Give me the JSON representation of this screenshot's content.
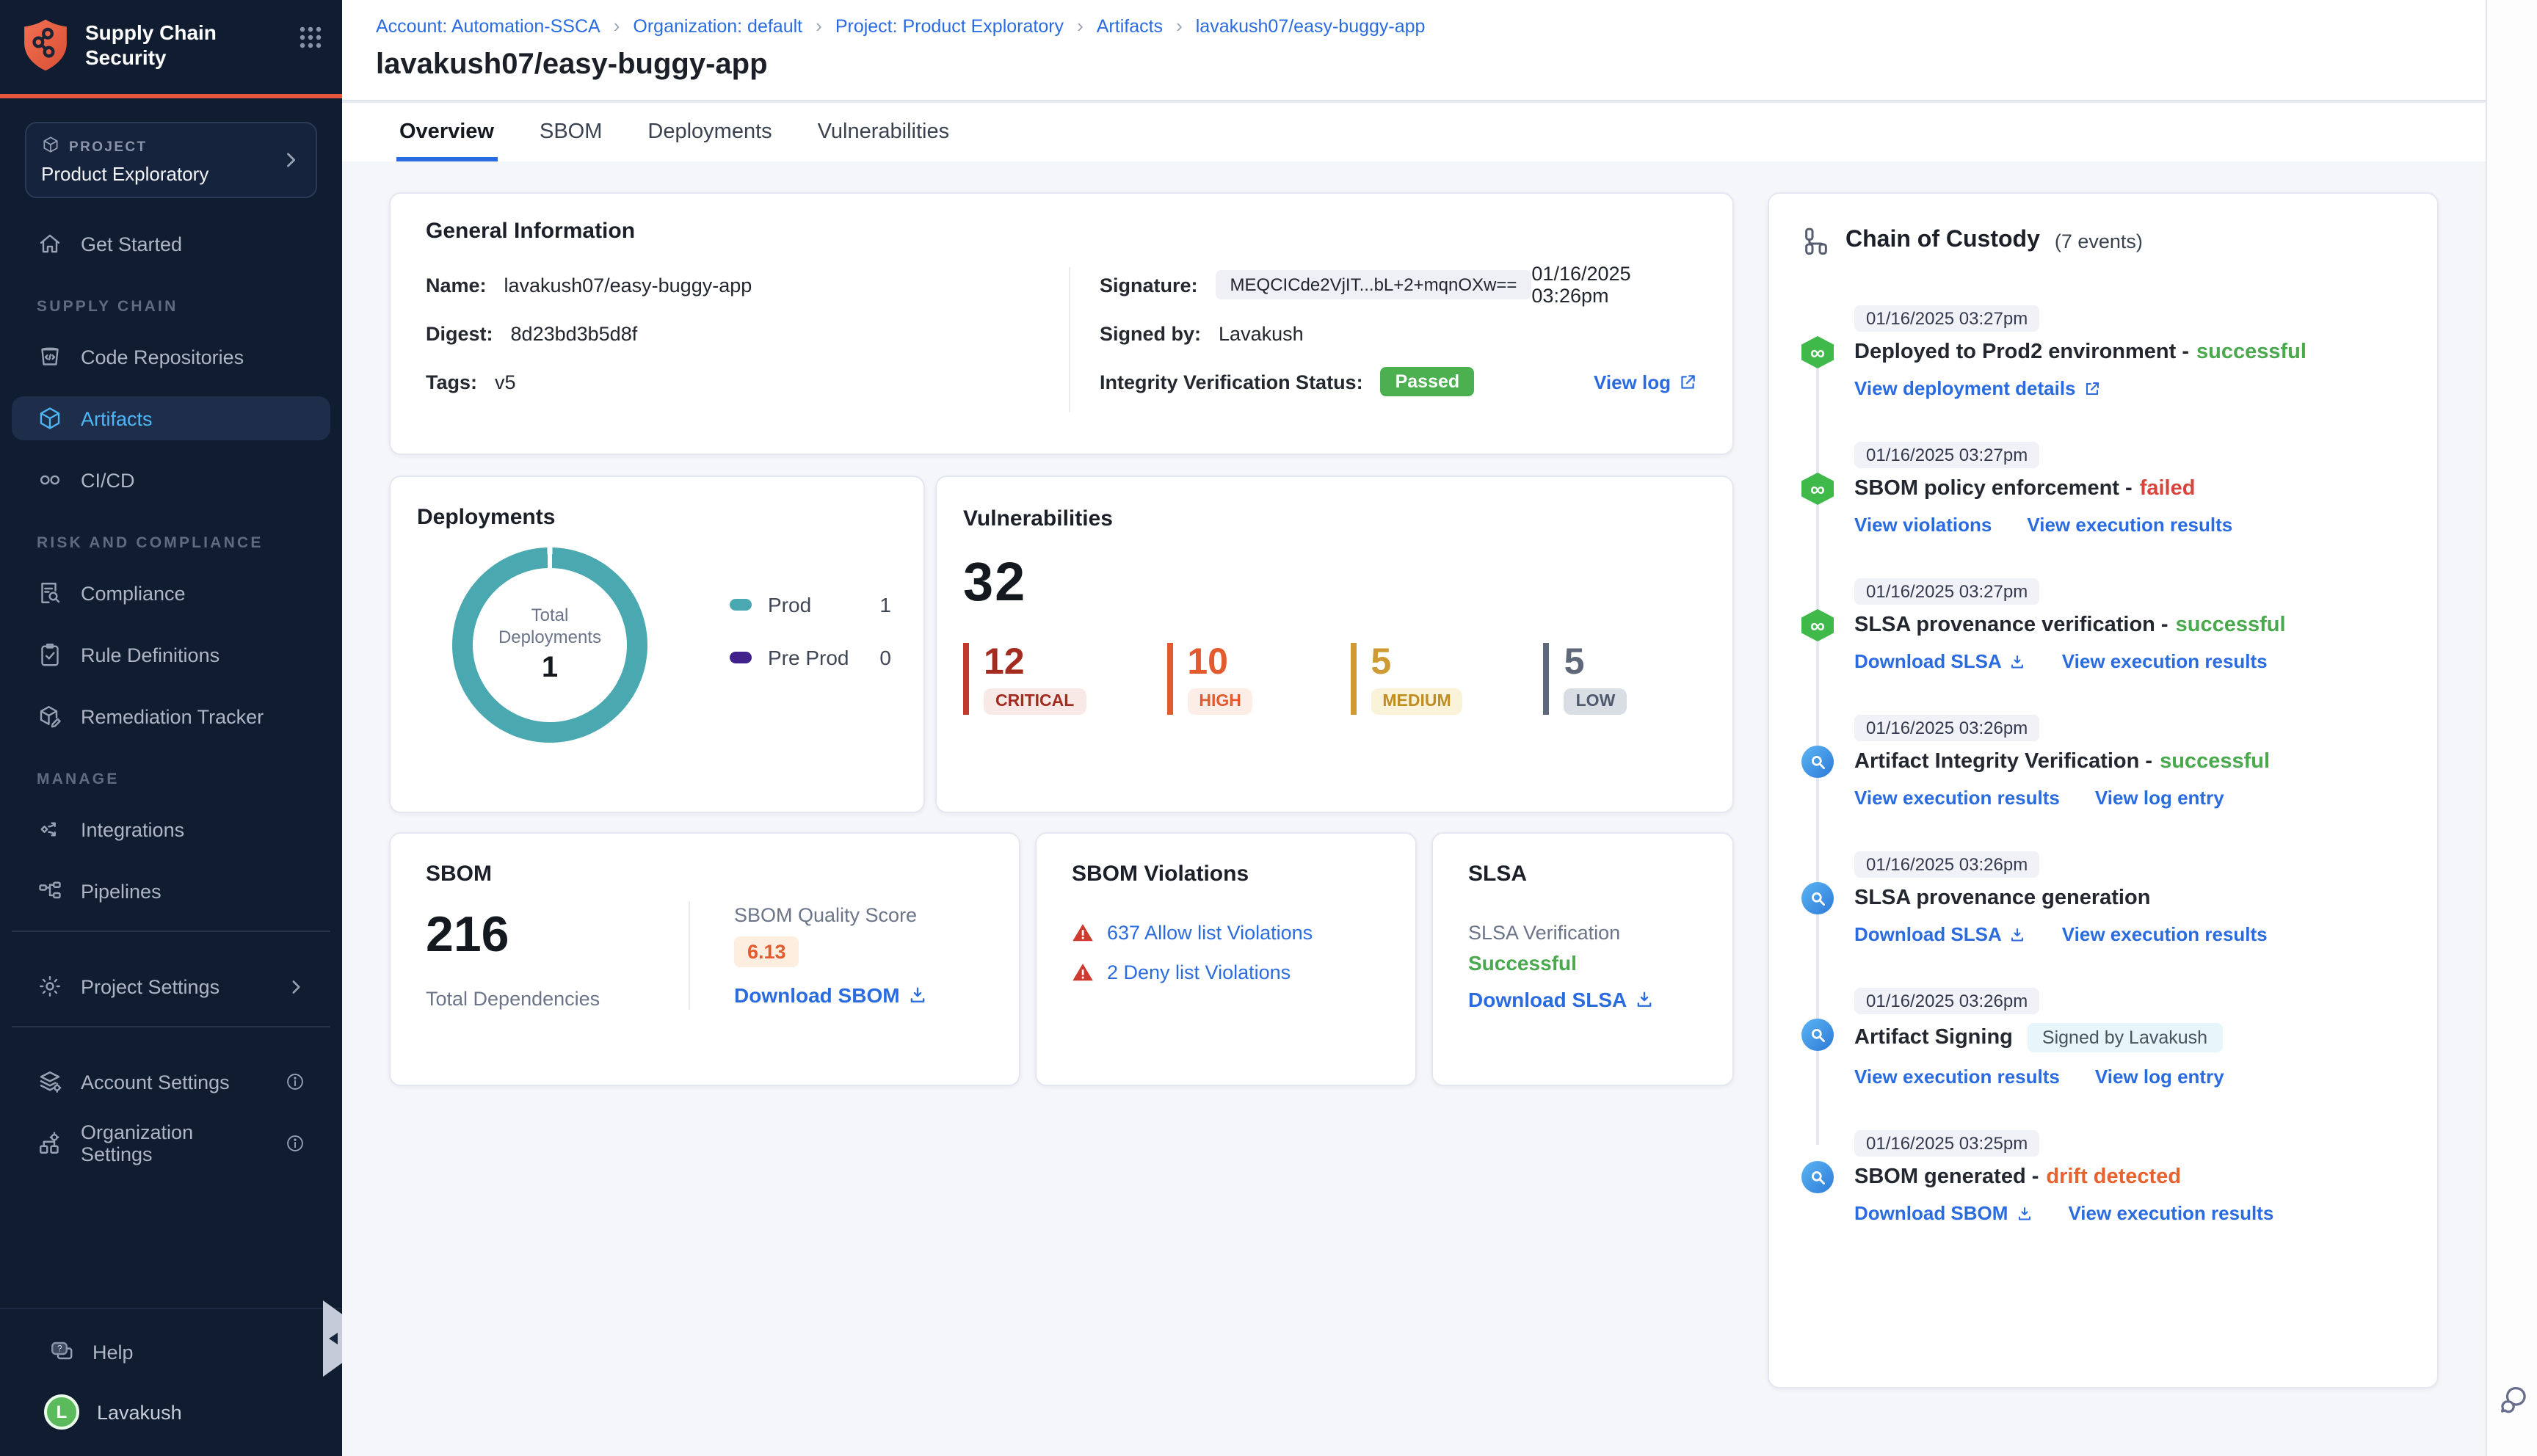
{
  "app": {
    "title": "Supply Chain Security"
  },
  "sidebar": {
    "project": {
      "label": "PROJECT",
      "name": "Product Exploratory"
    },
    "sections": {
      "supply_chain": "SUPPLY CHAIN",
      "risk": "RISK AND COMPLIANCE",
      "manage": "MANAGE"
    },
    "items": {
      "get_started": "Get Started",
      "code_repositories": "Code Repositories",
      "artifacts": "Artifacts",
      "cicd": "CI/CD",
      "compliance": "Compliance",
      "rule_definitions": "Rule Definitions",
      "remediation_tracker": "Remediation Tracker",
      "integrations": "Integrations",
      "pipelines": "Pipelines",
      "project_settings": "Project Settings",
      "account_settings": "Account Settings",
      "organization_settings": "Organization Settings",
      "help": "Help"
    },
    "user": {
      "initial": "L",
      "name": "Lavakush"
    }
  },
  "breadcrumb": {
    "items": [
      "Account: Automation-SSCA",
      "Organization: default",
      "Project: Product Exploratory",
      "Artifacts",
      "lavakush07/easy-buggy-app"
    ]
  },
  "page": {
    "title": "lavakush07/easy-buggy-app"
  },
  "tabs": [
    {
      "label": "Overview"
    },
    {
      "label": "SBOM"
    },
    {
      "label": "Deployments"
    },
    {
      "label": "Vulnerabilities"
    }
  ],
  "general_info": {
    "title": "General Information",
    "name_label": "Name:",
    "name": "lavakush07/easy-buggy-app",
    "digest_label": "Digest:",
    "digest": "8d23bd3b5d8f",
    "tags_label": "Tags:",
    "tags": "v5",
    "signature_label": "Signature:",
    "signature": "MEQCICde2VjIT...bL+2+mqnOXw==",
    "signature_time": "01/16/2025 03:26pm",
    "signed_by_label": "Signed by:",
    "signed_by": "Lavakush",
    "integrity_label": "Integrity Verification Status:",
    "integrity_status": "Passed",
    "view_log_label": "View log"
  },
  "deployments": {
    "title": "Deployments",
    "chart_data": {
      "type": "pie",
      "subtype": "donut",
      "center_label_line1": "Total",
      "center_label_line2": "Deployments",
      "total": "1",
      "series": [
        {
          "name": "Prod",
          "value": 1,
          "color": "#4aa8b1"
        },
        {
          "name": "Pre Prod",
          "value": 0,
          "color": "#41228d"
        }
      ]
    }
  },
  "vulnerabilities": {
    "title": "Vulnerabilities",
    "total": "32",
    "severities": [
      {
        "label": "CRITICAL",
        "count": "12",
        "color": "#a42b20"
      },
      {
        "label": "HIGH",
        "count": "10",
        "color": "#e25a2e"
      },
      {
        "label": "MEDIUM",
        "count": "5",
        "color": "#d09a33"
      },
      {
        "label": "LOW",
        "count": "5",
        "color": "#5d6878"
      }
    ]
  },
  "sbom": {
    "title": "SBOM",
    "total": "216",
    "total_label": "Total Dependencies",
    "quality_label": "SBOM Quality Score",
    "quality_score": "6.13",
    "download_label": "Download SBOM"
  },
  "sbom_violations": {
    "title": "SBOM Violations",
    "links": [
      {
        "label": "637 Allow list Violations"
      },
      {
        "label": "2 Deny list Violations"
      }
    ]
  },
  "slsa": {
    "title": "SLSA",
    "verification_label": "SLSA Verification",
    "status": "Successful",
    "download_label": "Download SLSA"
  },
  "chain_of_custody": {
    "title": "Chain of Custody",
    "events_count": "(7 events)",
    "events": [
      {
        "time": "01/16/2025 03:27pm",
        "title": "Deployed to Prod2 environment -",
        "status": "successful",
        "links": [
          {
            "label": "View deployment details"
          }
        ]
      },
      {
        "time": "01/16/2025 03:27pm",
        "title": "SBOM policy enforcement -",
        "status": "failed",
        "links": [
          {
            "label": "View violations"
          },
          {
            "label": "View execution results"
          }
        ]
      },
      {
        "time": "01/16/2025 03:27pm",
        "title": "SLSA provenance verification -",
        "status": "successful",
        "links": [
          {
            "label": "Download SLSA"
          },
          {
            "label": "View execution results"
          }
        ]
      },
      {
        "time": "01/16/2025 03:26pm",
        "title": "Artifact Integrity Verification -",
        "status": "successful",
        "links": [
          {
            "label": "View execution results"
          },
          {
            "label": "View log entry"
          }
        ]
      },
      {
        "time": "01/16/2025 03:26pm",
        "title": "SLSA provenance generation",
        "status": "",
        "links": [
          {
            "label": "Download SLSA"
          },
          {
            "label": "View execution results"
          }
        ]
      },
      {
        "time": "01/16/2025 03:26pm",
        "title": "Artifact Signing",
        "status": "",
        "badge": "Signed by Lavakush",
        "links": [
          {
            "label": "View execution results"
          },
          {
            "label": "View log entry"
          }
        ]
      },
      {
        "time": "01/16/2025 03:25pm",
        "title": "SBOM generated -",
        "status": "drift detected",
        "links": [
          {
            "label": "Download SBOM"
          },
          {
            "label": "View execution results"
          }
        ]
      }
    ]
  },
  "colors": {
    "accent_orange": "#e8563d",
    "link_blue": "#2a6ce0",
    "success_green": "#49a94c",
    "failed_red": "#d6453c",
    "drift_orange": "#e8622f",
    "sidebar_navy": "#101d31",
    "donut_teal": "#4aa8b1",
    "preprod_purple": "#41228d"
  }
}
